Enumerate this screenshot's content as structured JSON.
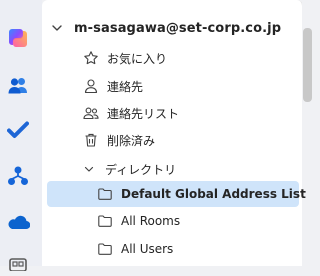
{
  "account": {
    "name": "m-sasagawa@set-corp.co.jp"
  },
  "folders": [
    {
      "label": "お気に入り",
      "icon": "star-icon"
    },
    {
      "label": "連絡先",
      "icon": "person-icon"
    },
    {
      "label": "連絡先リスト",
      "icon": "people-icon"
    },
    {
      "label": "削除済み",
      "icon": "trash-icon"
    },
    {
      "label": "ディレクトリ",
      "icon": "chevron-down-icon"
    }
  ],
  "directory": [
    {
      "label": "Default Global Address List",
      "icon": "folder-icon",
      "selected": true
    },
    {
      "label": "All Rooms",
      "icon": "folder-icon",
      "selected": false
    },
    {
      "label": "All Users",
      "icon": "folder-icon",
      "selected": false
    }
  ],
  "rail_apps": [
    "copilot-icon",
    "people-app-icon",
    "todo-icon",
    "org-icon",
    "onedrive-icon",
    "more-app-icon"
  ],
  "colors": {
    "selected_bg": "#cfe4fa",
    "accent": "#0f6cbd"
  }
}
